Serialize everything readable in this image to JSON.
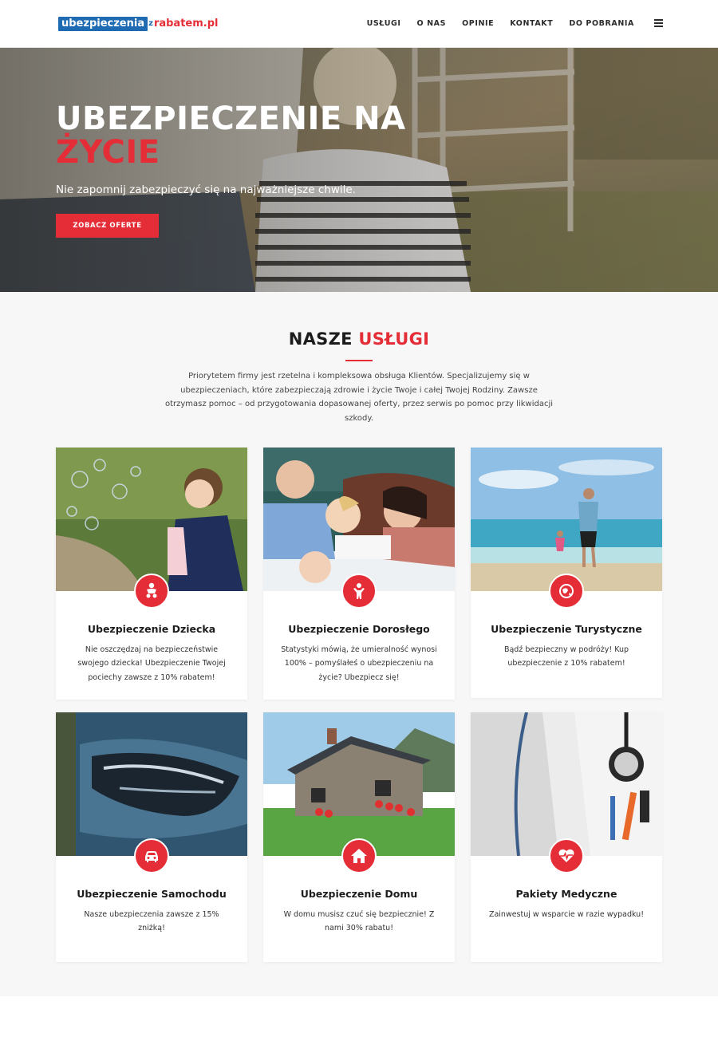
{
  "logo": {
    "part1": "ubezpieczenia",
    "part2": "z",
    "part3": "rabatem.pl"
  },
  "nav": {
    "items": [
      {
        "label": "USŁUGI"
      },
      {
        "label": "O NAS"
      },
      {
        "label": "OPINIE"
      },
      {
        "label": "KONTAKT"
      },
      {
        "label": "DO POBRANIA"
      }
    ],
    "menu_icon": "hamburger-icon"
  },
  "hero": {
    "title_line1": "UBEZPIECZENIE NA",
    "title_line2": "ŻYCIE",
    "subtitle": "Nie zapomnij zabezpieczyć się na najważniejsze chwile.",
    "button": "ZOBACZ OFERTE"
  },
  "services": {
    "title_part1": "NASZE",
    "title_part2": "USŁUGI",
    "description": "Priorytetem firmy jest rzetelna i kompleksowa obsługa Klientów. Specjalizujemy się w ubezpieczeniach, które zabezpieczają zdrowie i życie Twoje i całej Twojej Rodziny. Zawsze otrzymasz pomoc – od przygotowania dopasowanej oferty, przez serwis po pomoc przy likwidacji szkody.",
    "cards": [
      {
        "title": "Ubezpieczenie Dziecka",
        "text": "Nie oszczędzaj na bezpieczeństwie swojego dziecka! Ubezpieczenie Twojej pociechy zawsze z 10% rabatem!",
        "icon": "baby-icon"
      },
      {
        "title": "Ubezpieczenie Dorosłego",
        "text": "Statystyki mówią, że umieralność wynosi 100% – pomyślałeś o ubezpieczeniu na życie? Ubezpiecz się!",
        "icon": "person-icon"
      },
      {
        "title": "Ubezpieczenie Turystyczne",
        "text": "Bądź bezpieczny w podróży! Kup ubezpieczenie z 10% rabatem!",
        "icon": "globe-icon"
      },
      {
        "title": "Ubezpieczenie Samochodu",
        "text": "Nasze ubezpieczenia zawsze z 15% zniżką!",
        "icon": "car-icon"
      },
      {
        "title": "Ubezpieczenie Domu",
        "text": "W domu musisz czuć się bezpiecznie! Z nami 30% rabatu!",
        "icon": "house-icon"
      },
      {
        "title": "Pakiety Medyczne",
        "text": "Zainwestuj w wsparcie w razie wypadku!",
        "icon": "heartbeat-icon"
      }
    ]
  },
  "colors": {
    "accent": "#e42d36",
    "logo_blue": "#1f6bb3",
    "text_dark": "#1c1c1c"
  }
}
